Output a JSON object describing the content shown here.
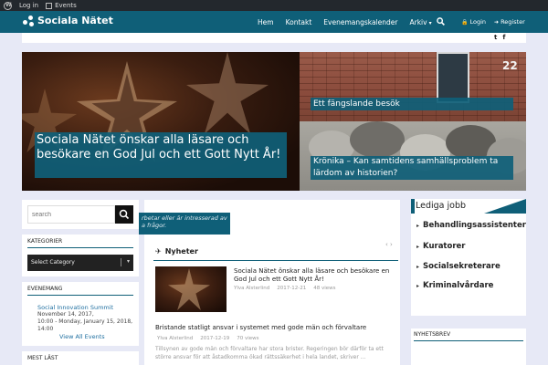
{
  "adminbar": {
    "login": "Log in",
    "events": "Events"
  },
  "header": {
    "site_name": "Sociala Nätet",
    "nav": [
      "Hem",
      "Kontakt",
      "Evenemangskalender",
      "Arkiv"
    ],
    "login": "Login",
    "register": "Register"
  },
  "social": {
    "twitter": "t",
    "facebook": "f"
  },
  "hero": {
    "main_caption": "Sociala Nätet önskar alla läsare och besökare en God Jul och ett Gott Nytt År!",
    "right_top_caption": "Ett fängslande besök",
    "right_bottom_caption": "Krönika – Kan samtidens samhällsproblem ta lärdom av historien?",
    "building_number": "22"
  },
  "sidebar": {
    "search_placeholder": "search",
    "categories_title": "KATEGORIER",
    "category_select": "Select Category",
    "events_title": "EVENEMANG",
    "event_name": "Social Innovation Summit",
    "event_date_line1": "November 14, 2017,",
    "event_date_line2": "10:00 - Monday, January 15, 2018,",
    "event_date_line3": "14:00",
    "view_all": "View All Events",
    "most_read_title": "MEST LÄST"
  },
  "center": {
    "overlay_line1": "rbetar eller är intresserad av",
    "overlay_line2": "a frågor.",
    "news_title": "Nyheter",
    "news_arrows": "‹  ›",
    "article1": {
      "title": "Sociala Nätet önskar alla läsare och besökare en God Jul och ett Gott Nytt År!",
      "author": "Ylva Alsterlind",
      "date": "2017-12-21",
      "views": "48 views"
    },
    "article2": {
      "title": "Bristande statligt ansvar i systemet med gode män och förvaltare",
      "author": "Ylva Alsterlind",
      "date": "2017-12-19",
      "views": "70 views",
      "excerpt": "Tillsynen av gode män och förvaltare har stora brister. Regeringen bör därför ta ett större ansvar för att åstadkomma ökad rättssäkerhet i hela landet, skriver ..."
    }
  },
  "right": {
    "jobs_title": "Lediga jobb",
    "jobs": [
      "Behandlingsassistenter",
      "Kuratorer",
      "Socialsekreterare",
      "Kriminalvårdare"
    ],
    "newsletter_title": "NYHETSBREV"
  },
  "colors": {
    "brand": "#0f5f78",
    "adminbar": "#23282d",
    "page_bg": "#e7e9f6"
  }
}
